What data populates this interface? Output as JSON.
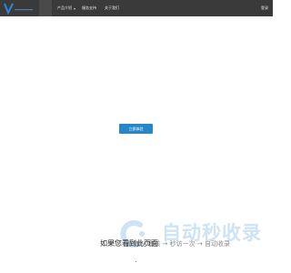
{
  "header": {
    "nav": {
      "products_label": "产品介绍",
      "solutions_label": "服务支持",
      "about_label": "关于我们"
    },
    "login_label": "登录"
  },
  "main": {
    "cta_label": "立即体验"
  },
  "watermark": {
    "title": "自动秒收录",
    "subtitle": "提交 → 审核 → 秒访一次 → 自动收录",
    "overlay_text": "如果您看到此页面"
  },
  "colors": {
    "topbar_bg": "#3a3a3a",
    "cta_bg": "#2587c9",
    "watermark_blue": "#cde4f4"
  },
  "icons": {
    "logo": "v-logo-icon",
    "chevron": "chevron-down-icon",
    "watermark_c": "c-logo-icon"
  }
}
